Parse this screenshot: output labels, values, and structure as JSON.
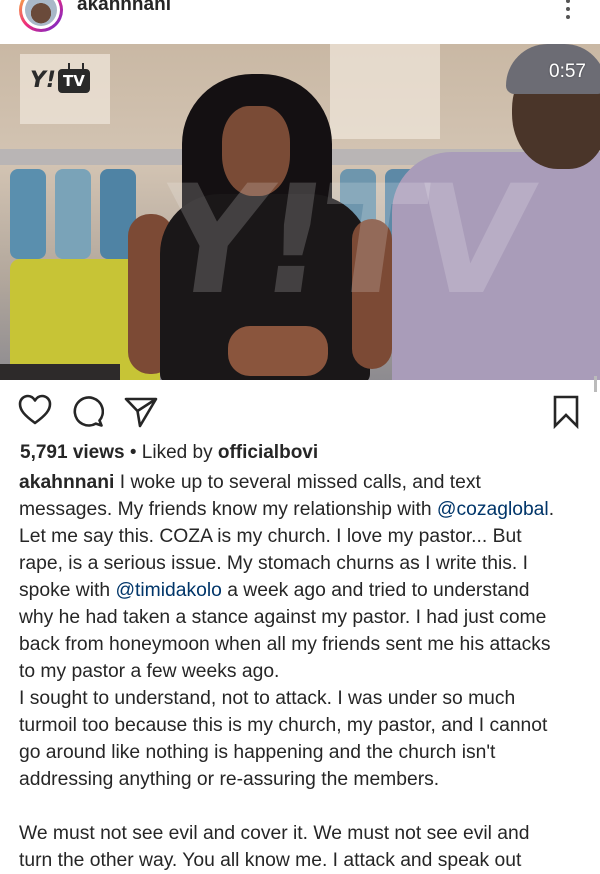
{
  "post": {
    "username": "akahnnani",
    "video": {
      "duration": "0:57",
      "logo_y": "Y!",
      "logo_tv": "TV",
      "watermark": "Y!TV"
    },
    "stats": {
      "views": "5,791 views",
      "liked_by_prefix": " • Liked by ",
      "liked_by_user": "officialbovi"
    },
    "caption_lines": [
      [
        {
          "t": "akahnnani",
          "k": "user"
        },
        {
          "t": " I woke up to several missed calls, and text"
        }
      ],
      [
        {
          "t": "messages. My friends know my relationship with "
        },
        {
          "t": "@cozaglobal",
          "k": "mention"
        },
        {
          "t": "."
        }
      ],
      [
        {
          "t": "Let me say this. COZA is my church. I love my pastor... But"
        }
      ],
      [
        {
          "t": "rape, is a serious issue. My stomach churns as I write this. I"
        }
      ],
      [
        {
          "t": "spoke with "
        },
        {
          "t": "@timidakolo",
          "k": "mention"
        },
        {
          "t": " a week ago and tried to understand"
        }
      ],
      [
        {
          "t": "why he had taken a stance against my pastor. I had just come"
        }
      ],
      [
        {
          "t": "back from honeymoon when all my friends sent me his attacks"
        }
      ],
      [
        {
          "t": "to my pastor a few weeks ago."
        }
      ],
      [
        {
          "t": "I sought to understand, not to attack. I was under so much"
        }
      ],
      [
        {
          "t": "turmoil too because this is my church, my pastor, and I cannot"
        }
      ],
      [
        {
          "t": "go around like nothing is happening and the church isn't"
        }
      ],
      [
        {
          "t": "addressing anything or re-assuring the members."
        }
      ],
      [],
      [
        {
          "t": "We must not see evil and cover it. We must not see evil and"
        }
      ],
      [
        {
          "t": "turn the other way. You all know me. I attack and speak out"
        }
      ]
    ],
    "icons": {
      "more": "more-vertical-icon",
      "like": "heart-icon",
      "comment": "comment-icon",
      "share": "paper-plane-icon",
      "save": "bookmark-icon"
    },
    "colors": {
      "text": "#262626",
      "mention": "#003569",
      "background": "#ffffff"
    }
  }
}
